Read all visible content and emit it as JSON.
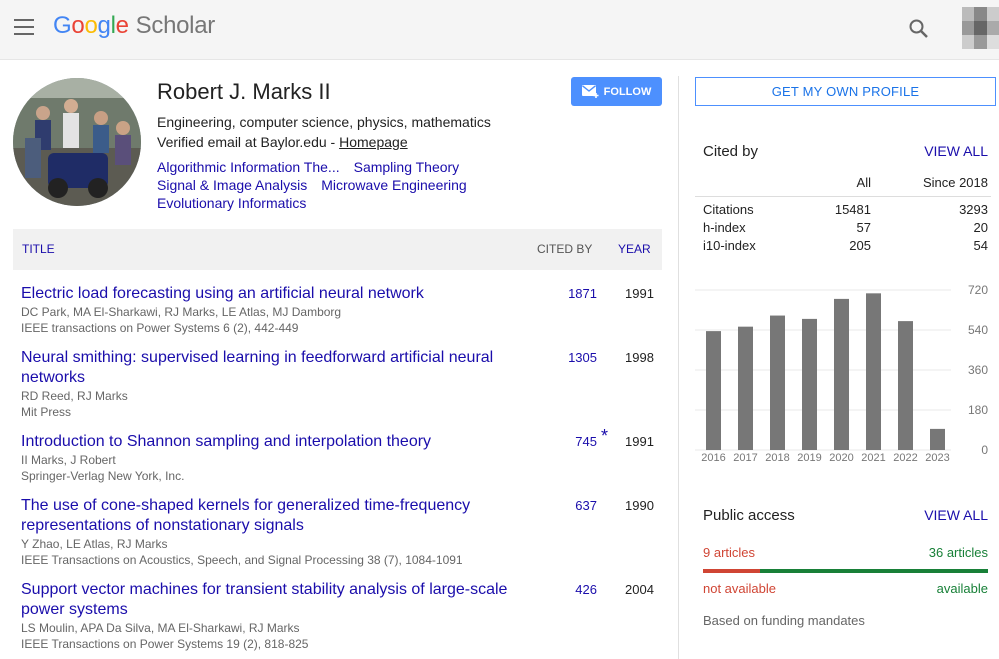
{
  "header": {
    "logo_google": [
      "G",
      "o",
      "o",
      "g",
      "l",
      "e"
    ],
    "logo_scholar": "Scholar"
  },
  "profile": {
    "name": "Robert J. Marks II",
    "affiliation": "Engineering, computer science, physics, mathematics",
    "email_text": "Verified email at Baylor.edu - ",
    "homepage_label": "Homepage",
    "interests": [
      "Algorithmic Information The...",
      "Sampling Theory",
      "Signal & Image Analysis",
      "Microwave Engineering",
      "Evolutionary Informatics"
    ],
    "follow_label": "FOLLOW"
  },
  "table": {
    "col_title": "TITLE",
    "col_cited": "CITED BY",
    "col_year": "YEAR",
    "articles": [
      {
        "title": "Electric load forecasting using an artificial neural network",
        "authors": "DC Park, MA El-Sharkawi, RJ Marks, LE Atlas, MJ Damborg",
        "venue": "IEEE transactions on Power Systems 6 (2), 442-449",
        "cites": "1871",
        "star": "",
        "year": "1991"
      },
      {
        "title": "Neural smithing: supervised learning in feedforward artificial neural networks",
        "authors": "RD Reed, RJ Marks",
        "venue": "Mit Press",
        "cites": "1305",
        "star": "",
        "year": "1998"
      },
      {
        "title": "Introduction to Shannon sampling and interpolation theory",
        "authors": "II Marks, J Robert",
        "venue": "Springer-Verlag New York, Inc.",
        "cites": "745",
        "star": "*",
        "year": "1991"
      },
      {
        "title": "The use of cone-shaped kernels for generalized time-frequency representations of nonstationary signals",
        "authors": "Y Zhao, LE Atlas, RJ Marks",
        "venue": "IEEE Transactions on Acoustics, Speech, and Signal Processing 38 (7), 1084-1091",
        "cites": "637",
        "star": "",
        "year": "1990"
      },
      {
        "title": "Support vector machines for transient stability analysis of large-scale power systems",
        "authors": "LS Moulin, APA Da Silva, MA El-Sharkawi, RJ Marks",
        "venue": "IEEE Transactions on Power Systems 19 (2), 818-825",
        "cites": "426",
        "star": "",
        "year": "2004"
      }
    ]
  },
  "sidebar": {
    "own_profile_label": "GET MY OWN PROFILE",
    "cited_by": {
      "title": "Cited by",
      "view_all": "VIEW ALL",
      "col_all": "All",
      "col_since": "Since 2018",
      "rows": [
        {
          "label": "Citations",
          "all": "15481",
          "since": "3293"
        },
        {
          "label": "h-index",
          "all": "57",
          "since": "20"
        },
        {
          "label": "i10-index",
          "all": "205",
          "since": "54"
        }
      ]
    },
    "public_access": {
      "title": "Public access",
      "view_all": "VIEW ALL",
      "unavailable_count": "9 articles",
      "available_count": "36 articles",
      "unavailable_label": "not available",
      "available_label": "available",
      "note": "Based on funding mandates",
      "unavailable_fraction": 0.2,
      "colors": {
        "unavailable": "#d04534",
        "available": "#188038"
      }
    }
  },
  "chart_data": {
    "type": "bar",
    "categories": [
      "2016",
      "2017",
      "2018",
      "2019",
      "2020",
      "2021",
      "2022",
      "2023"
    ],
    "values": [
      535,
      555,
      605,
      590,
      680,
      705,
      580,
      95
    ],
    "ylim": [
      0,
      720
    ],
    "yticks": [
      "720",
      "540",
      "360",
      "180",
      "0"
    ],
    "bar_color": "#777777"
  }
}
